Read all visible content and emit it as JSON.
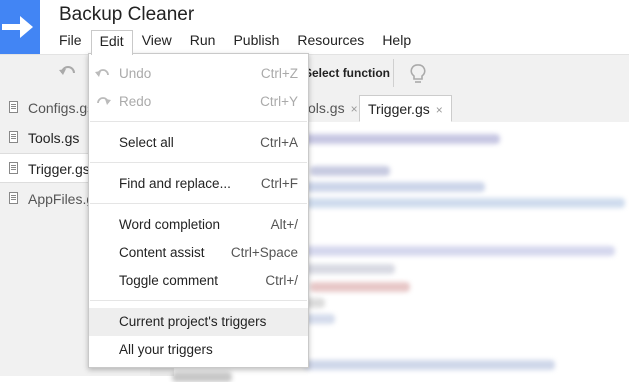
{
  "app": {
    "title": "Backup Cleaner",
    "logo_icon": "arrow-right-icon",
    "brand_color": "#4285f4"
  },
  "menubar": {
    "items": [
      "File",
      "Edit",
      "View",
      "Run",
      "Publish",
      "Resources",
      "Help"
    ],
    "open": "Edit"
  },
  "toolbar": {
    "select_function": "Select function",
    "undo_icon": "undo-icon",
    "debug_icon": "lightbulb-icon"
  },
  "files": [
    "Configs.gs",
    "Tools.gs",
    "Trigger.gs",
    "AppFiles.gs"
  ],
  "tabs": {
    "partial": "ols.gs",
    "active": "Trigger.gs",
    "close_glyph": "×"
  },
  "edit_menu": {
    "undo": {
      "label": "Undo",
      "shortcut": "Ctrl+Z"
    },
    "redo": {
      "label": "Redo",
      "shortcut": "Ctrl+Y"
    },
    "select_all": {
      "label": "Select all",
      "shortcut": "Ctrl+A"
    },
    "find_replace": {
      "label": "Find and replace...",
      "shortcut": "Ctrl+F"
    },
    "word_completion": {
      "label": "Word completion",
      "shortcut": "Alt+/"
    },
    "content_assist": {
      "label": "Content assist",
      "shortcut": "Ctrl+Space"
    },
    "toggle_comment": {
      "label": "Toggle comment",
      "shortcut": "Ctrl+/"
    },
    "current_triggers": {
      "label": "Current project's triggers"
    },
    "all_triggers": {
      "label": "All your triggers"
    }
  }
}
